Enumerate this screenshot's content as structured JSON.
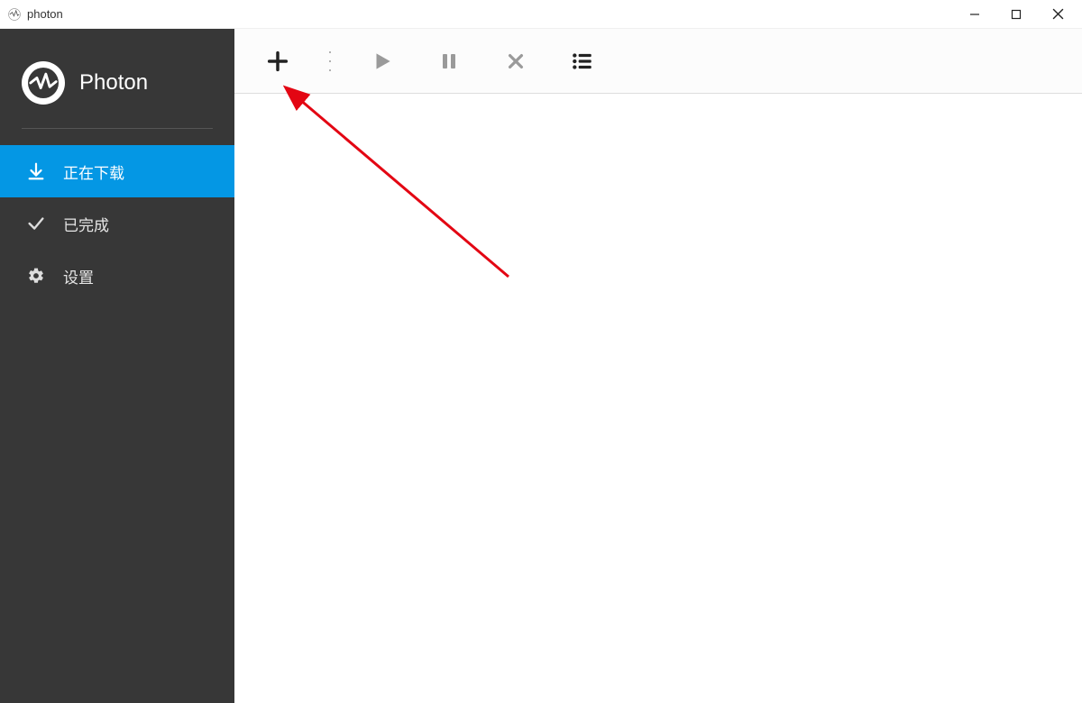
{
  "window": {
    "title": "photon"
  },
  "brand": {
    "name": "Photon"
  },
  "sidebar": {
    "items": [
      {
        "label": "正在下载",
        "icon": "download-icon",
        "active": true
      },
      {
        "label": "已完成",
        "icon": "check-icon",
        "active": false
      },
      {
        "label": "设置",
        "icon": "gear-icon",
        "active": false
      }
    ]
  },
  "toolbar": {
    "add": "add",
    "play": "play",
    "pause": "pause",
    "close": "close",
    "list": "list"
  }
}
